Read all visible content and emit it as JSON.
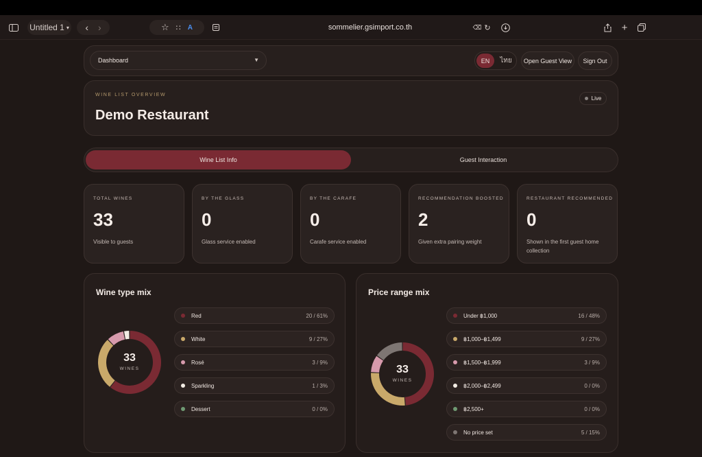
{
  "browser": {
    "tab_title": "Untitled 1",
    "url": "sommelier.gsimport.co.th"
  },
  "header": {
    "view_select": "Dashboard",
    "lang_en": "EN",
    "lang_th": "ไทย",
    "open_guest_view": "Open Guest View",
    "sign_out": "Sign Out"
  },
  "overview": {
    "eyebrow": "WINE LIST OVERVIEW",
    "title": "Demo Restaurant",
    "status": "Live"
  },
  "tabs": [
    {
      "label": "Wine List Info",
      "active": true
    },
    {
      "label": "Guest Interaction",
      "active": false
    }
  ],
  "stats": [
    {
      "label": "TOTAL WINES",
      "value": "33",
      "sub": "Visible to guests"
    },
    {
      "label": "BY THE GLASS",
      "value": "0",
      "sub": "Glass service enabled"
    },
    {
      "label": "BY THE CARAFE",
      "value": "0",
      "sub": "Carafe service enabled"
    },
    {
      "label": "RECOMMENDATION BOOSTED",
      "value": "2",
      "sub": "Given extra pairing weight"
    },
    {
      "label": "RESTAURANT RECOMMENDED",
      "value": "0",
      "sub": "Shown in the first guest home collection"
    }
  ],
  "wine_type_mix": {
    "title": "Wine type mix",
    "total": "33",
    "unit": "WINES",
    "items": [
      {
        "name": "Red",
        "value": "20 / 61%",
        "count": 20,
        "color": "#7a2a33"
      },
      {
        "name": "White",
        "value": "9 / 27%",
        "count": 9,
        "color": "#c9a96a"
      },
      {
        "name": "Rosé",
        "value": "3 / 9%",
        "count": 3,
        "color": "#d79aac"
      },
      {
        "name": "Sparkling",
        "value": "1 / 3%",
        "count": 1,
        "color": "#f2ece4"
      },
      {
        "name": "Dessert",
        "value": "0 / 0%",
        "count": 0,
        "color": "#6f9a73"
      }
    ]
  },
  "price_range_mix": {
    "title": "Price range mix",
    "total": "33",
    "unit": "WINES",
    "items": [
      {
        "name": "Under ฿1,000",
        "value": "16 / 48%",
        "count": 16,
        "color": "#7a2a33"
      },
      {
        "name": "฿1,000–฿1,499",
        "value": "9 / 27%",
        "count": 9,
        "color": "#c9a96a"
      },
      {
        "name": "฿1,500–฿1,999",
        "value": "3 / 9%",
        "count": 3,
        "color": "#d79aac"
      },
      {
        "name": "฿2,000–฿2,499",
        "value": "0 / 0%",
        "count": 0,
        "color": "#f2ece4"
      },
      {
        "name": "฿2,500+",
        "value": "0 / 0%",
        "count": 0,
        "color": "#6f9a73"
      },
      {
        "name": "No price set",
        "value": "5 / 15%",
        "count": 5,
        "color": "#7e7673"
      }
    ]
  }
}
